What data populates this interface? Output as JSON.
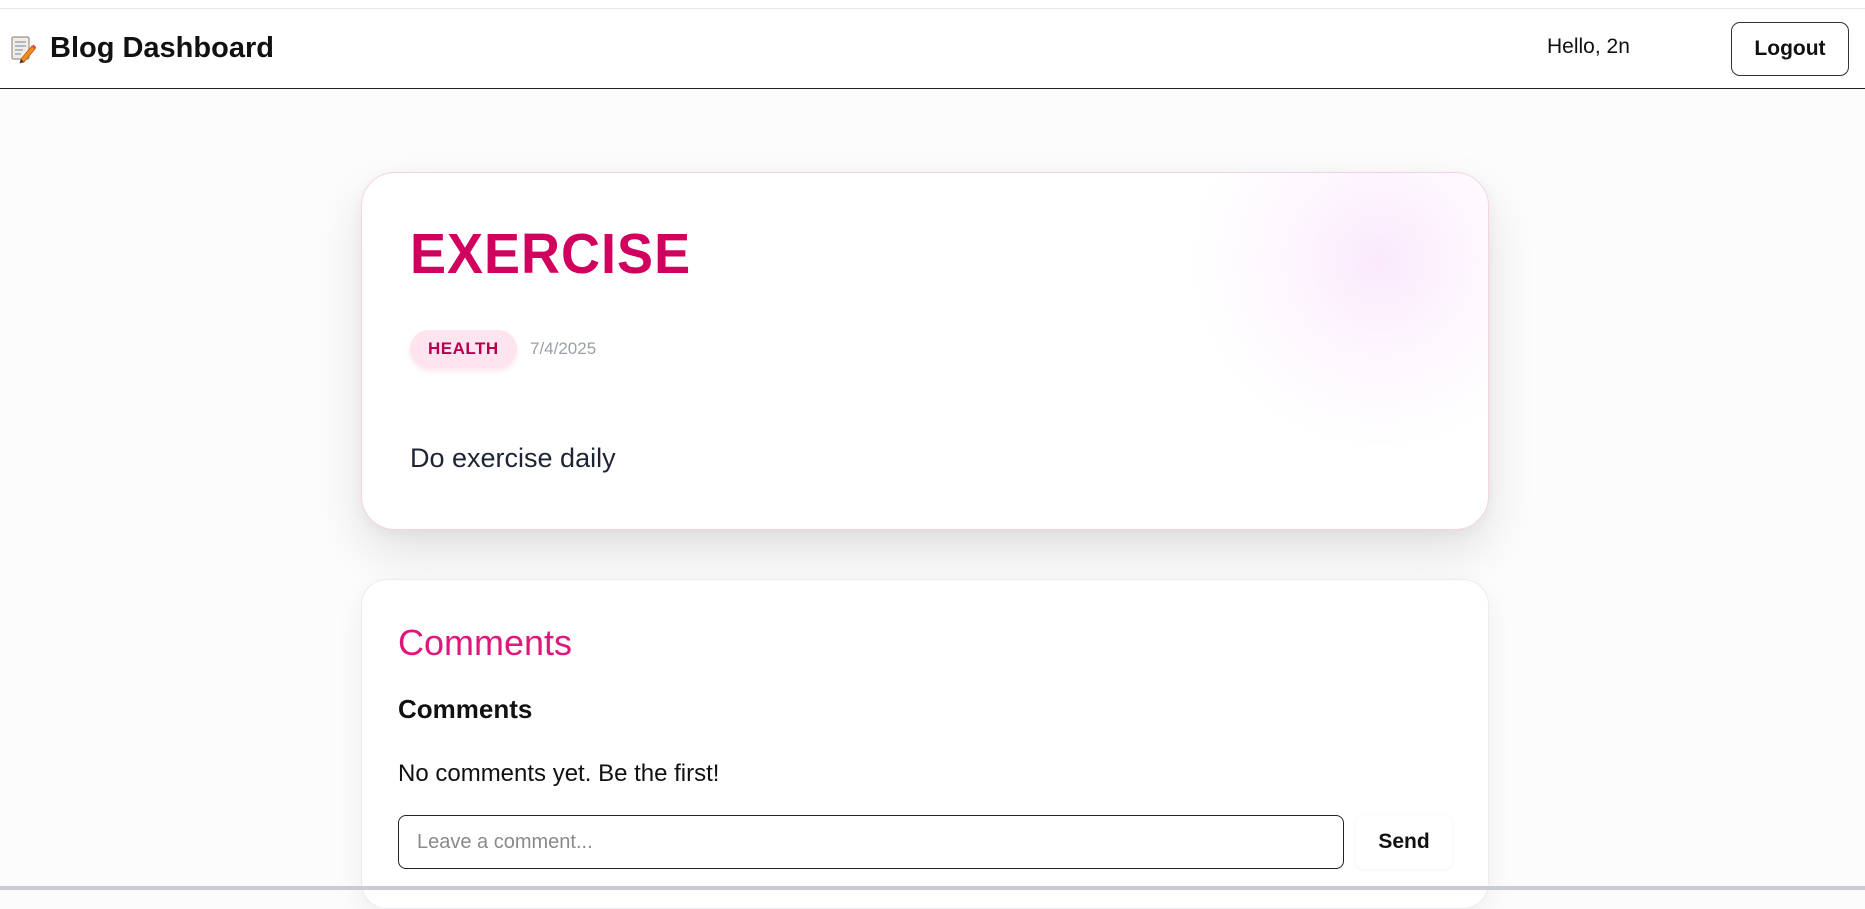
{
  "navbar": {
    "brand_icon": "memo-pencil-icon",
    "brand_title": "Blog Dashboard",
    "greeting": "Hello, 2n",
    "logout_label": "Logout"
  },
  "post": {
    "title": "EXERCISE",
    "category": "HEALTH",
    "date": "7/4/2025",
    "body": "Do exercise daily"
  },
  "comments": {
    "heading": "Comments",
    "subheading": "Comments",
    "empty_message": "No comments yet. Be the first!",
    "input_placeholder": "Leave a comment...",
    "send_label": "Send"
  },
  "colors": {
    "accent": "#d1005f",
    "comments_heading": "#e0177a",
    "tag_bg": "#fde4ef"
  }
}
